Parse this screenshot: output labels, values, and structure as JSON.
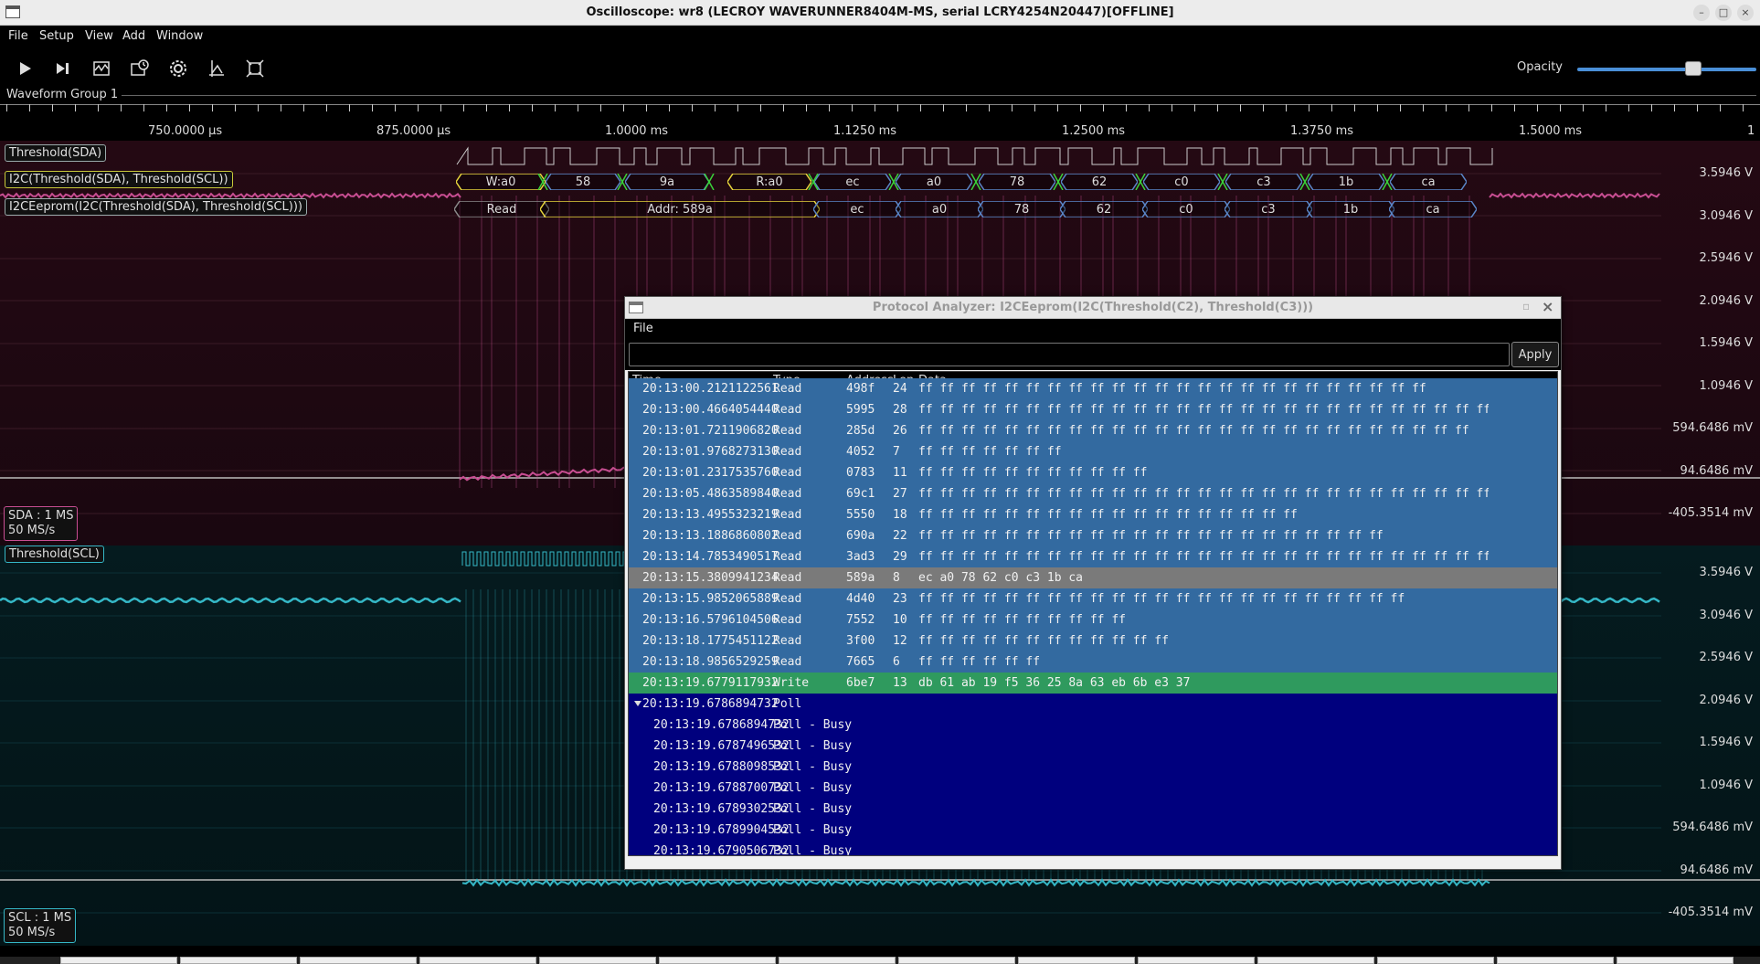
{
  "window": {
    "title": "Oscilloscope: wr8 (LECROY WAVERUNNER8404M-MS, serial LCRY4254N20447)[OFFLINE]"
  },
  "menu": [
    "File",
    "Setup",
    "View",
    "Add",
    "Window"
  ],
  "toolbar": {
    "buttons": [
      "play-icon",
      "step-icon",
      "waveform-icon",
      "history-icon",
      "settings-icon",
      "cursor-icon",
      "zoom-fit-icon"
    ],
    "opacity_label": "Opacity",
    "opacity_value": 0.9
  },
  "waveform_group": "Waveform Group 1",
  "timeline": {
    "labels": [
      "750.0000 µs",
      "875.0000 µs",
      "1.0000 ms",
      "1.1250 ms",
      "1.2500 ms",
      "1.3750 ms",
      "1.5000 ms",
      "1"
    ]
  },
  "waveform1": {
    "channels": {
      "threshold_sda": "Threshold(SDA)",
      "i2c": "I2C(Threshold(SDA), Threshold(SCL))",
      "eeprom": "I2CEeprom(I2C(Threshold(SDA), Threshold(SCL)))"
    },
    "scale": {
      "line1": "SDA : 1 MS",
      "line2": "50 MS/s"
    },
    "y_labels": [
      "3.5946 V",
      "3.0946 V",
      "2.5946 V",
      "2.0946 V",
      "1.5946 V",
      "1.0946 V",
      "594.6486 mV",
      "94.6486 mV",
      "-405.3514 mV"
    ],
    "i2c_packets": [
      "W:a0",
      "58",
      "9a",
      "R:a0",
      "ec",
      "a0",
      "78",
      "62",
      "c0",
      "c3",
      "1b",
      "ca"
    ],
    "eeprom_packets": [
      "Read",
      "Addr: 589a",
      "ec",
      "a0",
      "78",
      "62",
      "c0",
      "c3",
      "1b",
      "ca"
    ]
  },
  "waveform2": {
    "channels": {
      "threshold_scl": "Threshold(SCL)"
    },
    "scale": {
      "line1": "SCL : 1 MS",
      "line2": "50 MS/s"
    },
    "y_labels": [
      "3.5946 V",
      "3.0946 V",
      "2.5946 V",
      "2.0946 V",
      "1.5946 V",
      "1.0946 V",
      "594.6486 mV",
      "94.6486 mV",
      "-405.3514 mV"
    ]
  },
  "protocol_analyzer": {
    "title": "Protocol Analyzer: I2CEeprom(I2C(Threshold(C2), Threshold(C3)))",
    "menu_file": "File",
    "filter_value": "",
    "apply_label": "Apply",
    "columns": {
      "time": "Time",
      "type": "Type",
      "address": "Address",
      "len": "Len",
      "data": "Data"
    },
    "rows": [
      {
        "time": "20:13:00.2121122561",
        "type": "Read",
        "address": "498f",
        "len": "24",
        "data": "ff ff ff ff ff ff ff ff ff ff ff ff ff ff ff ff ff ff ff ff ff ff ff ff",
        "kind": "read",
        "child": false
      },
      {
        "time": "20:13:00.4664054440",
        "type": "Read",
        "address": "5995",
        "len": "28",
        "data": "ff ff ff ff ff ff ff ff ff ff ff ff ff ff ff ff ff ff ff ff ff ff ff ff ff ff ff ff",
        "kind": "read",
        "child": false
      },
      {
        "time": "20:13:01.7211906820",
        "type": "Read",
        "address": "285d",
        "len": "26",
        "data": "ff ff ff ff ff ff ff ff ff ff ff ff ff ff ff ff ff ff ff ff ff ff ff ff ff ff",
        "kind": "read",
        "child": false
      },
      {
        "time": "20:13:01.9768273130",
        "type": "Read",
        "address": "4052",
        "len": "7",
        "data": "ff ff ff ff ff ff ff",
        "kind": "read",
        "child": false
      },
      {
        "time": "20:13:01.2317535760",
        "type": "Read",
        "address": "0783",
        "len": "11",
        "data": "ff ff ff ff ff ff ff ff ff ff ff",
        "kind": "read",
        "child": false
      },
      {
        "time": "20:13:05.4863589840",
        "type": "Read",
        "address": "69c1",
        "len": "27",
        "data": "ff ff ff ff ff ff ff ff ff ff ff ff ff ff ff ff ff ff ff ff ff ff ff ff ff ff ff",
        "kind": "read",
        "child": false
      },
      {
        "time": "20:13:13.4955323219",
        "type": "Read",
        "address": "5550",
        "len": "18",
        "data": "ff ff ff ff ff ff ff ff ff ff ff ff ff ff ff ff ff ff",
        "kind": "read",
        "child": false
      },
      {
        "time": "20:13:13.1886860802",
        "type": "Read",
        "address": "690a",
        "len": "22",
        "data": "ff ff ff ff ff ff ff ff ff ff ff ff ff ff ff ff ff ff ff ff ff ff",
        "kind": "read",
        "child": false
      },
      {
        "time": "20:13:14.7853490517",
        "type": "Read",
        "address": "3ad3",
        "len": "29",
        "data": "ff ff ff ff ff ff ff ff ff ff ff ff ff ff ff ff ff ff ff ff ff ff ff ff ff ff ff ff ff",
        "kind": "read",
        "child": false
      },
      {
        "time": "20:13:15.3809941234",
        "type": "Read",
        "address": "589a",
        "len": "8",
        "data": "ec a0 78 62 c0 c3 1b ca",
        "kind": "selected",
        "child": false
      },
      {
        "time": "20:13:15.9852065889",
        "type": "Read",
        "address": "4d40",
        "len": "23",
        "data": "ff ff ff ff ff ff ff ff ff ff ff ff ff ff ff ff ff ff ff ff ff ff ff",
        "kind": "read",
        "child": false
      },
      {
        "time": "20:13:16.5796104506",
        "type": "Read",
        "address": "7552",
        "len": "10",
        "data": "ff ff ff ff ff ff ff ff ff ff",
        "kind": "read",
        "child": false
      },
      {
        "time": "20:13:18.1775451122",
        "type": "Read",
        "address": "3f00",
        "len": "12",
        "data": "ff ff ff ff ff ff ff ff ff ff ff ff",
        "kind": "read",
        "child": false
      },
      {
        "time": "20:13:18.9856529259",
        "type": "Read",
        "address": "7665",
        "len": "6",
        "data": "ff ff ff ff ff ff",
        "kind": "read",
        "child": false
      },
      {
        "time": "20:13:19.6779117932",
        "type": "Write",
        "address": "6be7",
        "len": "13",
        "data": "db 61 ab 19 f5 36 25 8a 63 eb 6b e3 37",
        "kind": "write",
        "child": false
      },
      {
        "time": "20:13:19.6786894732",
        "type": "Poll",
        "address": "",
        "len": "",
        "data": "",
        "kind": "poll",
        "child": false,
        "expanded": true
      },
      {
        "time": "20:13:19.6786894732",
        "type": "Poll - Busy",
        "address": "",
        "len": "",
        "data": "",
        "kind": "poll",
        "child": true
      },
      {
        "time": "20:13:19.6787496532",
        "type": "Poll - Busy",
        "address": "",
        "len": "",
        "data": "",
        "kind": "poll",
        "child": true
      },
      {
        "time": "20:13:19.6788098532",
        "type": "Poll - Busy",
        "address": "",
        "len": "",
        "data": "",
        "kind": "poll",
        "child": true
      },
      {
        "time": "20:13:19.6788700732",
        "type": "Poll - Busy",
        "address": "",
        "len": "",
        "data": "",
        "kind": "poll",
        "child": true
      },
      {
        "time": "20:13:19.6789302532",
        "type": "Poll - Busy",
        "address": "",
        "len": "",
        "data": "",
        "kind": "poll",
        "child": true
      },
      {
        "time": "20:13:19.6789904532",
        "type": "Poll - Busy",
        "address": "",
        "len": "",
        "data": "",
        "kind": "poll",
        "child": true
      },
      {
        "time": "20:13:19.6790506732",
        "type": "Poll - Busy",
        "address": "",
        "len": "",
        "data": "",
        "kind": "poll",
        "child": true
      }
    ]
  },
  "colors": {
    "sda": "#c84e92",
    "scl": "#35b7c6",
    "packet_yellow": "#e6d43c",
    "packet_blue": "#5a86c8",
    "packet_green": "#3ad33a",
    "read_row": "#336aa0",
    "write_row": "#2f9a5e",
    "selected_row": "#7a7a7a",
    "poll_row": "#00007e"
  }
}
